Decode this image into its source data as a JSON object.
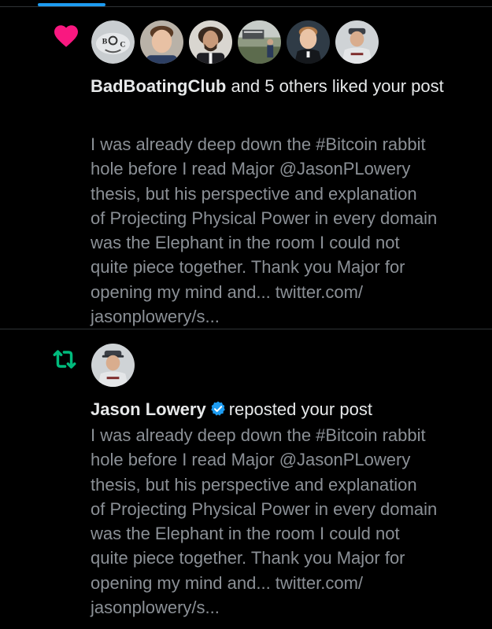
{
  "colors": {
    "background": "#000000",
    "tab_accent": "#1d9bf0",
    "like_heart": "#f91880",
    "repost_green": "#00ba7c",
    "verified_blue": "#1d9bf0",
    "primary_text": "#e7e9ea",
    "secondary_text": "#8b9096",
    "divider": "#2f3336"
  },
  "notifications": [
    {
      "type": "like",
      "icon": "heart-icon",
      "avatars": [
        {
          "icon": "avatar-badboatingclub"
        },
        {
          "icon": "avatar-user-2"
        },
        {
          "icon": "avatar-user-3"
        },
        {
          "icon": "avatar-user-4"
        },
        {
          "icon": "avatar-user-5"
        },
        {
          "icon": "avatar-user-6"
        }
      ],
      "actor": "BadBoatingClub",
      "action": " and 5 others liked your post",
      "post_text": "I was already deep down the #Bitcoin rabbit\nhole before I read Major @JasonPLowery\nthesis, but his perspective and explanation\nof Projecting Physical Power in every domain\nwas the Elephant in the room I could not\nquite piece together.  Thank you Major for\nopening my mind and... twitter.com/\njasonplowery/s..."
    },
    {
      "type": "repost",
      "icon": "repost-icon",
      "avatars": [
        {
          "icon": "avatar-jason-lowery"
        }
      ],
      "actor": "Jason Lowery",
      "verified": true,
      "action": "reposted your post",
      "post_text": "I was already deep down the #Bitcoin rabbit\nhole before I read Major @JasonPLowery\nthesis, but his perspective and explanation\nof Projecting Physical Power in every domain\nwas the Elephant in the room I could not\nquite piece together.  Thank you Major for\nopening my mind and... twitter.com/\njasonplowery/s..."
    }
  ]
}
